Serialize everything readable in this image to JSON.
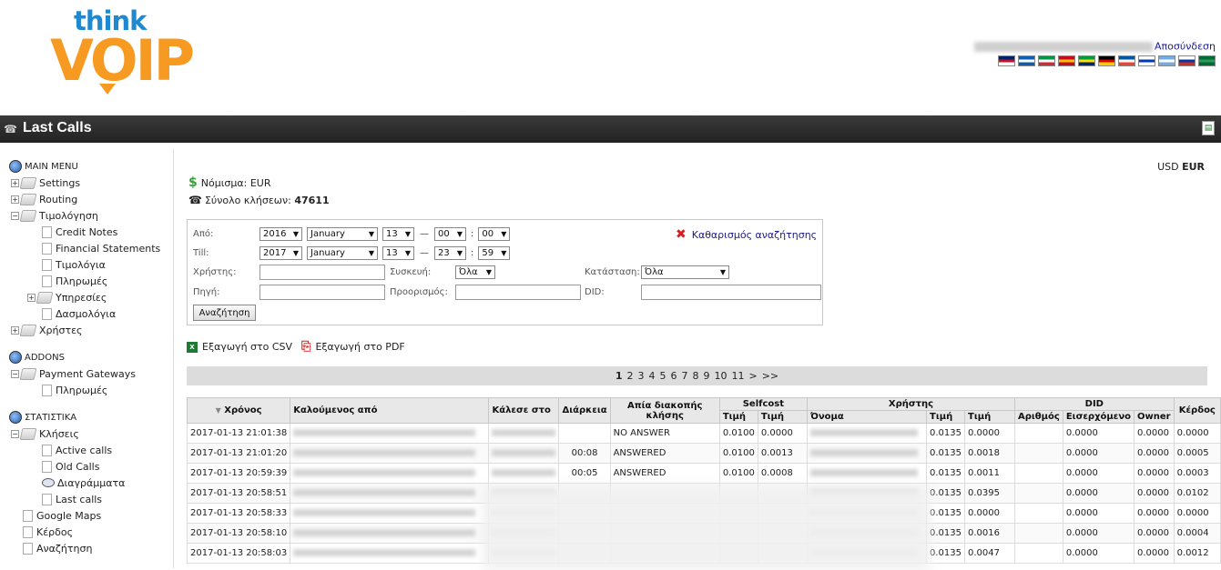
{
  "header": {
    "logo_top": "think",
    "logo_bottom": "VOIP",
    "logout": "Αποσύνδεση",
    "flags": [
      {
        "name": "uk-flag",
        "colors": [
          "#012169",
          "#c8102e",
          "#ffffff"
        ]
      },
      {
        "name": "greece-flag",
        "colors": [
          "#0d5eaf",
          "#ffffff",
          "#0d5eaf"
        ]
      },
      {
        "name": "italy-flag",
        "colors": [
          "#009246",
          "#ffffff",
          "#ce2b37"
        ]
      },
      {
        "name": "spain-flag",
        "colors": [
          "#c60b1e",
          "#ffc400",
          "#c60b1e"
        ]
      },
      {
        "name": "brazil-flag",
        "colors": [
          "#009c3b",
          "#ffdf00",
          "#002776"
        ]
      },
      {
        "name": "germany-flag",
        "colors": [
          "#000000",
          "#dd0000",
          "#ffce00"
        ]
      },
      {
        "name": "france-flag",
        "colors": [
          "#0055a4",
          "#ffffff",
          "#ef4135"
        ]
      },
      {
        "name": "israel-flag",
        "colors": [
          "#ffffff",
          "#0038b8",
          "#ffffff"
        ]
      },
      {
        "name": "argentina-flag",
        "colors": [
          "#74acdf",
          "#ffffff",
          "#74acdf"
        ]
      },
      {
        "name": "russia-flag",
        "colors": [
          "#ffffff",
          "#0039a6",
          "#d52b1e"
        ]
      },
      {
        "name": "saudi-flag",
        "colors": [
          "#006c35",
          "#2f9a5a",
          "#006c35"
        ]
      }
    ]
  },
  "titlebar": {
    "title": "Last Calls"
  },
  "sidebar": {
    "main_menu": "MAIN MENU",
    "settings": "Settings",
    "routing": "Routing",
    "billing": "Τιμολόγηση",
    "credit_notes": "Credit Notes",
    "financial_statements": "Financial Statements",
    "invoices": "Τιμολόγια",
    "payments": "Πληρωμές",
    "services": "Υπηρεσίες",
    "tariffs": "Δασμολόγια",
    "users": "Χρήστες",
    "addons": "ADDONS",
    "payment_gateways": "Payment Gateways",
    "pg_payments": "Πληρωμές",
    "statistics": "ΣΤΑΤΙΣΤΙΚΑ",
    "calls": "Κλήσεις",
    "active_calls": "Active calls",
    "old_calls": "Old Calls",
    "charts": "Διαγράμματα",
    "last_calls": "Last calls",
    "google_maps": "Google Maps",
    "profit": "Κέρδος",
    "search": "Αναζήτηση"
  },
  "main": {
    "currency_prefix": "USD",
    "currency_active": "EUR",
    "currency_label": "Νόμισμα: EUR",
    "total_calls_label": "Σύνολο κλήσεων:",
    "total_calls_value": "47611",
    "search": {
      "from_label": "Από:",
      "till_label": "Till:",
      "from_year": "2016",
      "from_month": "January",
      "from_day": "13",
      "from_hour": "00",
      "from_min": "00",
      "till_year": "2017",
      "till_month": "January",
      "till_day": "13",
      "till_hour": "23",
      "till_min": "59",
      "clear": "Καθαρισμός αναζήτησης",
      "user_label": "Χρήστης:",
      "device_label": "Συσκευή:",
      "device_value": "Όλα",
      "status_label": "Κατάσταση:",
      "status_value": "Όλα",
      "source_label": "Πηγή:",
      "destination_label": "Προορισμός:",
      "did_label": "DID:",
      "button": "Αναζήτηση"
    },
    "export_csv": "Εξαγωγή στο CSV",
    "export_pdf": "Εξαγωγή στο PDF",
    "pager": [
      "1",
      "2",
      "3",
      "4",
      "5",
      "6",
      "7",
      "8",
      "9",
      "10",
      "11",
      ">",
      ">>"
    ],
    "table": {
      "h_time": "Χρόνος",
      "h_caller": "Καλούμενος από",
      "h_called": "Κάλεσε στο",
      "h_duration": "Διάρκεια",
      "h_hangup": "Απία διακοπής κλήσης",
      "h_selfcost": "Selfcost",
      "h_user": "Χρήστης",
      "h_did": "DID",
      "h_profit": "Κέρδος",
      "h_price": "Τιμή",
      "h_name": "Όνομα",
      "h_did_number": "Αριθμός",
      "h_incoming": "Εισερχόμενο",
      "h_owner": "Owner",
      "rows": [
        {
          "time": "2017-01-13 21:01:38",
          "duration": "",
          "status": "NO ANSWER",
          "sc1": "0.0100",
          "sc2": "0.0000",
          "name": "",
          "u1": "0.0135",
          "u2": "0.0000",
          "did": "",
          "inc": "0.0000",
          "own": "0.0000",
          "profit": "0.0000"
        },
        {
          "time": "2017-01-13 21:01:20",
          "duration": "00:08",
          "status": "ANSWERED",
          "sc1": "0.0100",
          "sc2": "0.0013",
          "name": "",
          "u1": "0.0135",
          "u2": "0.0018",
          "did": "",
          "inc": "0.0000",
          "own": "0.0000",
          "profit": "0.0005"
        },
        {
          "time": "2017-01-13 20:59:39",
          "duration": "00:05",
          "status": "ANSWERED",
          "sc1": "0.0100",
          "sc2": "0.0008",
          "name": "",
          "u1": "0.0135",
          "u2": "0.0011",
          "did": "",
          "inc": "0.0000",
          "own": "0.0000",
          "profit": "0.0003"
        },
        {
          "time": "2017-01-13 20:58:51",
          "duration": "",
          "status": "",
          "sc1": "",
          "sc2": "",
          "name": "",
          "u1": "0.0135",
          "u2": "0.0395",
          "did": "",
          "inc": "0.0000",
          "own": "0.0000",
          "profit": "0.0102"
        },
        {
          "time": "2017-01-13 20:58:33",
          "duration": "",
          "status": "",
          "sc1": "",
          "sc2": "",
          "name": "",
          "u1": "0.0135",
          "u2": "0.0000",
          "did": "",
          "inc": "0.0000",
          "own": "0.0000",
          "profit": "0.0000"
        },
        {
          "time": "2017-01-13 20:58:10",
          "duration": "",
          "status": "",
          "sc1": "",
          "sc2": "",
          "name": "",
          "u1": "0.0135",
          "u2": "0.0016",
          "did": "",
          "inc": "0.0000",
          "own": "0.0000",
          "profit": "0.0004"
        },
        {
          "time": "2017-01-13 20:58:03",
          "duration": "",
          "status": "",
          "sc1": "",
          "sc2": "",
          "name": "",
          "u1": "0.0135",
          "u2": "0.0047",
          "did": "",
          "inc": "0.0000",
          "own": "0.0000",
          "profit": "0.0012"
        }
      ]
    }
  }
}
